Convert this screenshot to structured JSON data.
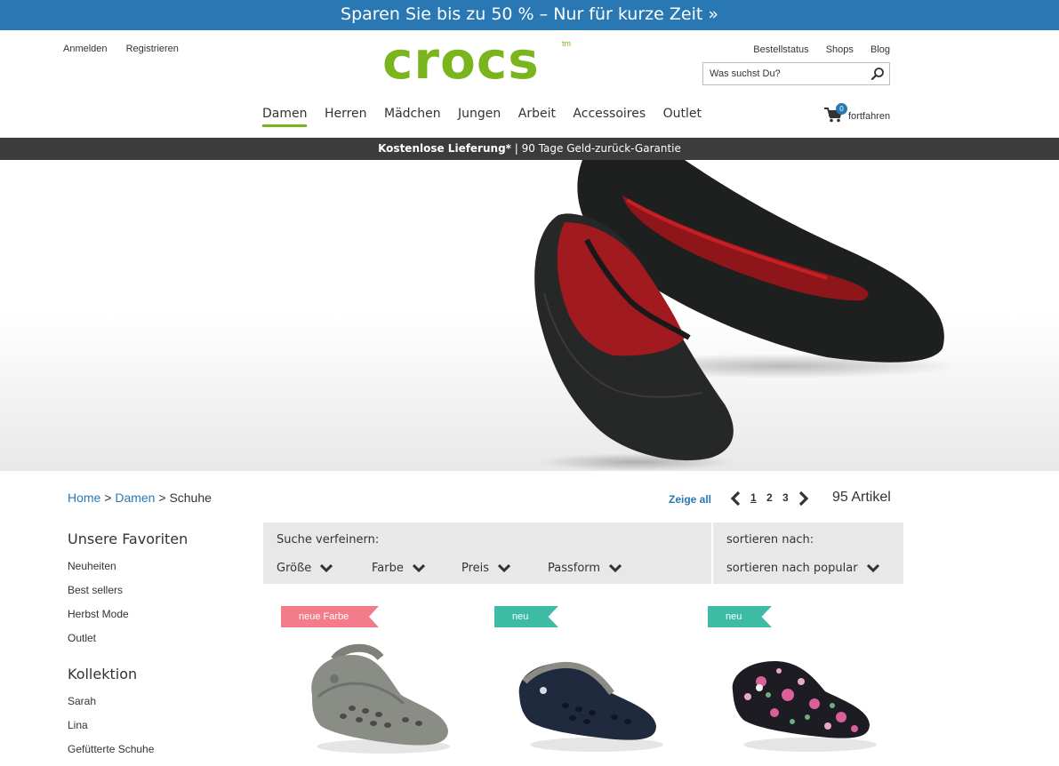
{
  "promo": {
    "text": "Sparen Sie bis zu 50 % – Nur für kurze Zeit »"
  },
  "header": {
    "account_links": [
      "Anmelden",
      "Registrieren"
    ],
    "logo_text": "crocs",
    "logo_tm": "tm",
    "util_links": [
      "Bestellstatus",
      "Shops",
      "Blog"
    ],
    "search_placeholder": "Was suchst Du?",
    "search_icon": "magnifier-icon",
    "cart": {
      "count": "0",
      "label": "fortfahren",
      "icon": "shopping-cart-icon"
    }
  },
  "nav": {
    "items": [
      "Damen",
      "Herren",
      "Mädchen",
      "Jungen",
      "Arbeit",
      "Accessoires",
      "Outlet"
    ],
    "active": "Damen"
  },
  "shipping": {
    "bold": "Kostenlose Lieferung*",
    "rest": " | 90 Tage Geld-zurück-Garantie"
  },
  "breadcrumb": {
    "home": "Home",
    "sep1": " > ",
    "section": "Damen",
    "sep2": " > ",
    "current": "Schuhe"
  },
  "pagination": {
    "show_all": "Zeige all",
    "pages": [
      "1",
      "2",
      "3"
    ],
    "current": "1",
    "count": "95 Artikel"
  },
  "sidebar": {
    "sections": [
      {
        "heading": "Unsere Favoriten",
        "items": [
          "Neuheiten",
          "Best sellers",
          "Herbst Mode",
          "Outlet"
        ]
      },
      {
        "heading": "Kollektion",
        "items": [
          "Sarah",
          "Lina",
          "Gefütterte Schuhe"
        ]
      }
    ]
  },
  "filters": {
    "title": "Suche verfeinern:",
    "items": [
      "Größe",
      "Farbe",
      "Preis",
      "Passform"
    ],
    "sort_title": "sortieren nach:",
    "sort_value": "sortieren nach popular"
  },
  "products": [
    {
      "badge": "neue Farbe",
      "badge_color": "#f47c8a",
      "shoe_color": "#8a8c86"
    },
    {
      "badge": "neu",
      "badge_color": "#3ebba4",
      "shoe_color": "#1f2a3f"
    },
    {
      "badge": "neu",
      "badge_color": "#3ebba4",
      "shoe_color": "#1c1c22"
    }
  ],
  "colors": {
    "brand_green": "#7ab51d",
    "brand_blue": "#2a78b3",
    "bar_dark": "#3c3c3c",
    "panel_gray": "#e8e8e8"
  }
}
